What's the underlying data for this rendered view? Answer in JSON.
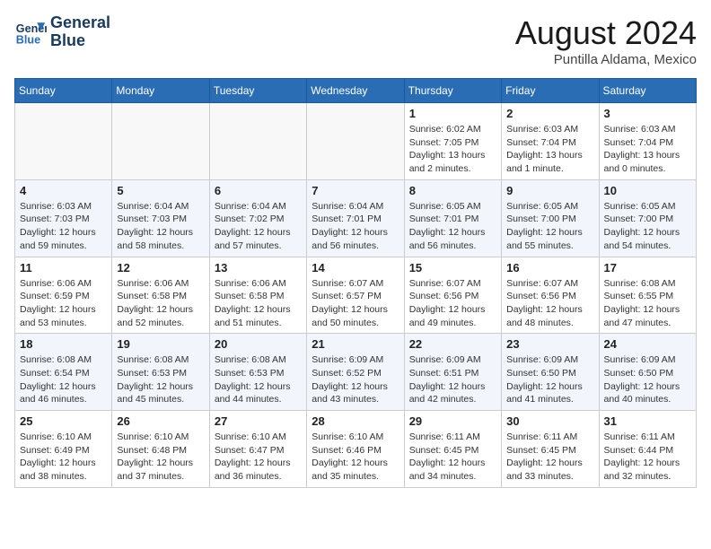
{
  "header": {
    "logo_line1": "General",
    "logo_line2": "Blue",
    "month": "August 2024",
    "location": "Puntilla Aldama, Mexico"
  },
  "days_of_week": [
    "Sunday",
    "Monday",
    "Tuesday",
    "Wednesday",
    "Thursday",
    "Friday",
    "Saturday"
  ],
  "weeks": [
    [
      {
        "day": "",
        "info": ""
      },
      {
        "day": "",
        "info": ""
      },
      {
        "day": "",
        "info": ""
      },
      {
        "day": "",
        "info": ""
      },
      {
        "day": "1",
        "info": "Sunrise: 6:02 AM\nSunset: 7:05 PM\nDaylight: 13 hours\nand 2 minutes."
      },
      {
        "day": "2",
        "info": "Sunrise: 6:03 AM\nSunset: 7:04 PM\nDaylight: 13 hours\nand 1 minute."
      },
      {
        "day": "3",
        "info": "Sunrise: 6:03 AM\nSunset: 7:04 PM\nDaylight: 13 hours\nand 0 minutes."
      }
    ],
    [
      {
        "day": "4",
        "info": "Sunrise: 6:03 AM\nSunset: 7:03 PM\nDaylight: 12 hours\nand 59 minutes."
      },
      {
        "day": "5",
        "info": "Sunrise: 6:04 AM\nSunset: 7:03 PM\nDaylight: 12 hours\nand 58 minutes."
      },
      {
        "day": "6",
        "info": "Sunrise: 6:04 AM\nSunset: 7:02 PM\nDaylight: 12 hours\nand 57 minutes."
      },
      {
        "day": "7",
        "info": "Sunrise: 6:04 AM\nSunset: 7:01 PM\nDaylight: 12 hours\nand 56 minutes."
      },
      {
        "day": "8",
        "info": "Sunrise: 6:05 AM\nSunset: 7:01 PM\nDaylight: 12 hours\nand 56 minutes."
      },
      {
        "day": "9",
        "info": "Sunrise: 6:05 AM\nSunset: 7:00 PM\nDaylight: 12 hours\nand 55 minutes."
      },
      {
        "day": "10",
        "info": "Sunrise: 6:05 AM\nSunset: 7:00 PM\nDaylight: 12 hours\nand 54 minutes."
      }
    ],
    [
      {
        "day": "11",
        "info": "Sunrise: 6:06 AM\nSunset: 6:59 PM\nDaylight: 12 hours\nand 53 minutes."
      },
      {
        "day": "12",
        "info": "Sunrise: 6:06 AM\nSunset: 6:58 PM\nDaylight: 12 hours\nand 52 minutes."
      },
      {
        "day": "13",
        "info": "Sunrise: 6:06 AM\nSunset: 6:58 PM\nDaylight: 12 hours\nand 51 minutes."
      },
      {
        "day": "14",
        "info": "Sunrise: 6:07 AM\nSunset: 6:57 PM\nDaylight: 12 hours\nand 50 minutes."
      },
      {
        "day": "15",
        "info": "Sunrise: 6:07 AM\nSunset: 6:56 PM\nDaylight: 12 hours\nand 49 minutes."
      },
      {
        "day": "16",
        "info": "Sunrise: 6:07 AM\nSunset: 6:56 PM\nDaylight: 12 hours\nand 48 minutes."
      },
      {
        "day": "17",
        "info": "Sunrise: 6:08 AM\nSunset: 6:55 PM\nDaylight: 12 hours\nand 47 minutes."
      }
    ],
    [
      {
        "day": "18",
        "info": "Sunrise: 6:08 AM\nSunset: 6:54 PM\nDaylight: 12 hours\nand 46 minutes."
      },
      {
        "day": "19",
        "info": "Sunrise: 6:08 AM\nSunset: 6:53 PM\nDaylight: 12 hours\nand 45 minutes."
      },
      {
        "day": "20",
        "info": "Sunrise: 6:08 AM\nSunset: 6:53 PM\nDaylight: 12 hours\nand 44 minutes."
      },
      {
        "day": "21",
        "info": "Sunrise: 6:09 AM\nSunset: 6:52 PM\nDaylight: 12 hours\nand 43 minutes."
      },
      {
        "day": "22",
        "info": "Sunrise: 6:09 AM\nSunset: 6:51 PM\nDaylight: 12 hours\nand 42 minutes."
      },
      {
        "day": "23",
        "info": "Sunrise: 6:09 AM\nSunset: 6:50 PM\nDaylight: 12 hours\nand 41 minutes."
      },
      {
        "day": "24",
        "info": "Sunrise: 6:09 AM\nSunset: 6:50 PM\nDaylight: 12 hours\nand 40 minutes."
      }
    ],
    [
      {
        "day": "25",
        "info": "Sunrise: 6:10 AM\nSunset: 6:49 PM\nDaylight: 12 hours\nand 38 minutes."
      },
      {
        "day": "26",
        "info": "Sunrise: 6:10 AM\nSunset: 6:48 PM\nDaylight: 12 hours\nand 37 minutes."
      },
      {
        "day": "27",
        "info": "Sunrise: 6:10 AM\nSunset: 6:47 PM\nDaylight: 12 hours\nand 36 minutes."
      },
      {
        "day": "28",
        "info": "Sunrise: 6:10 AM\nSunset: 6:46 PM\nDaylight: 12 hours\nand 35 minutes."
      },
      {
        "day": "29",
        "info": "Sunrise: 6:11 AM\nSunset: 6:45 PM\nDaylight: 12 hours\nand 34 minutes."
      },
      {
        "day": "30",
        "info": "Sunrise: 6:11 AM\nSunset: 6:45 PM\nDaylight: 12 hours\nand 33 minutes."
      },
      {
        "day": "31",
        "info": "Sunrise: 6:11 AM\nSunset: 6:44 PM\nDaylight: 12 hours\nand 32 minutes."
      }
    ]
  ]
}
